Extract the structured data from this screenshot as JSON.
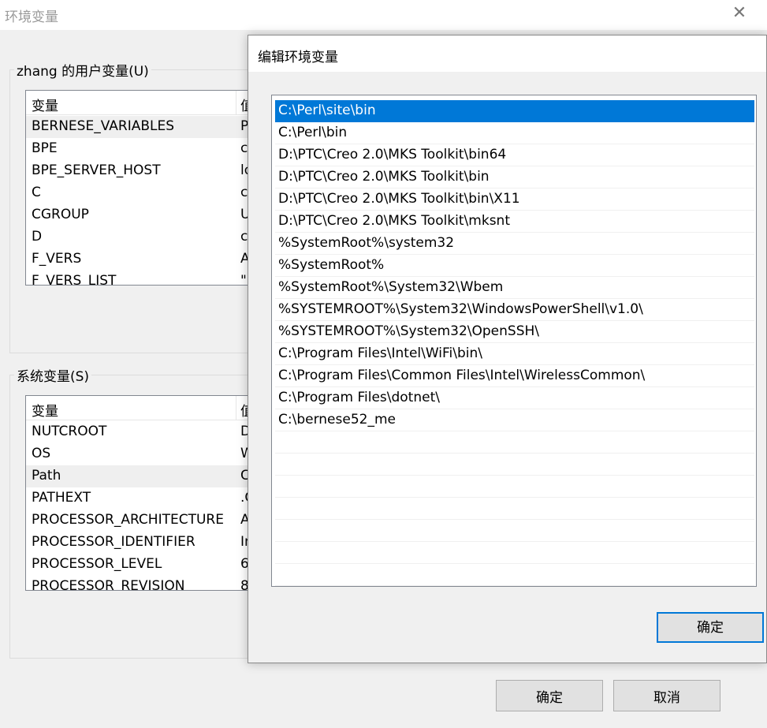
{
  "main_window": {
    "title": "环境变量",
    "close_glyph": "✕",
    "user_group": {
      "label": "zhang 的用户变量(U)",
      "columns": [
        "变量",
        "值"
      ],
      "rows": [
        {
          "name": "BERNESE_VARIABLES",
          "value": "P"
        },
        {
          "name": "BPE",
          "value": "c"
        },
        {
          "name": "BPE_SERVER_HOST",
          "value": "lo"
        },
        {
          "name": "C",
          "value": "c"
        },
        {
          "name": "CGROUP",
          "value": "U"
        },
        {
          "name": "D",
          "value": "c"
        },
        {
          "name": "F_VERS",
          "value": "A"
        },
        {
          "name": "F_VERS_LIST",
          "value": "\""
        }
      ]
    },
    "system_group": {
      "label": "系统变量(S)",
      "columns": [
        "变量",
        "值"
      ],
      "rows": [
        {
          "name": "NUTCROOT",
          "value": "D"
        },
        {
          "name": "OS",
          "value": "W"
        },
        {
          "name": "Path",
          "value": "C"
        },
        {
          "name": "PATHEXT",
          "value": ".C"
        },
        {
          "name": "PROCESSOR_ARCHITECTURE",
          "value": "A"
        },
        {
          "name": "PROCESSOR_IDENTIFIER",
          "value": "In"
        },
        {
          "name": "PROCESSOR_LEVEL",
          "value": "6"
        },
        {
          "name": "PROCESSOR_REVISION",
          "value": "8"
        }
      ]
    },
    "ok_label": "确定",
    "cancel_label": "取消"
  },
  "edit_dialog": {
    "title": "编辑环境变量",
    "paths": [
      "C:\\Perl\\site\\bin",
      "C:\\Perl\\bin",
      "D:\\PTC\\Creo 2.0\\MKS Toolkit\\bin64",
      "D:\\PTC\\Creo 2.0\\MKS Toolkit\\bin",
      "D:\\PTC\\Creo 2.0\\MKS Toolkit\\bin\\X11",
      "D:\\PTC\\Creo 2.0\\MKS Toolkit\\mksnt",
      "%SystemRoot%\\system32",
      "%SystemRoot%",
      "%SystemRoot%\\System32\\Wbem",
      "%SYSTEMROOT%\\System32\\WindowsPowerShell\\v1.0\\",
      "%SYSTEMROOT%\\System32\\OpenSSH\\",
      "C:\\Program Files\\Intel\\WiFi\\bin\\",
      "C:\\Program Files\\Common Files\\Intel\\WirelessCommon\\",
      "C:\\Program Files\\dotnet\\",
      "C:\\bernese52_me"
    ],
    "ok_label": "确定"
  }
}
